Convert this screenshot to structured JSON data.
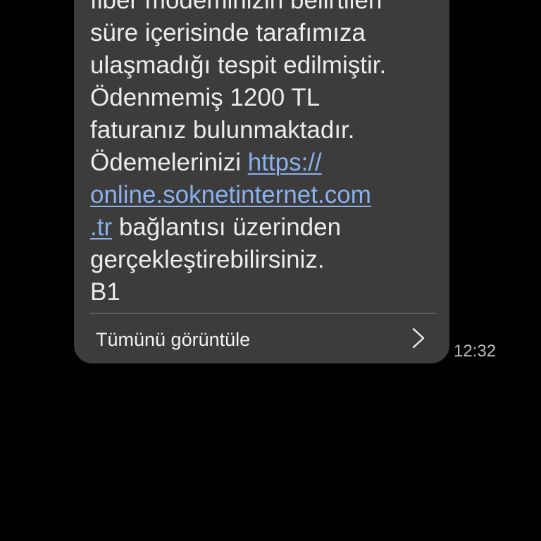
{
  "message": {
    "lines": {
      "l0": "fiber modeminizin belirtilen",
      "l1": "süre içerisinde tarafımıza",
      "l2": "ulaşmadığı tespit edilmiştir.",
      "l3": "Ödenmemiş 1200 TL",
      "l4": "faturanız bulunmaktadır.",
      "l5_prefix": "Ödemelerinizi ",
      "l5_link": "https://",
      "l6_link": "online.soknetinternet.com",
      "l7_link": ".tr",
      "l7_suffix": " bağlantısı üzerinden",
      "l8": "gerçekleştirebilirsiniz.",
      "l9": "B1"
    },
    "view_all_label": "Tümünü görüntüle",
    "timestamp": "12:32"
  },
  "colors": {
    "background": "#000000",
    "bubble": "#3c3c3c",
    "text": "#ececec",
    "link": "#8ab0ee"
  },
  "icons": {
    "view_all": "chevron-right-icon"
  }
}
